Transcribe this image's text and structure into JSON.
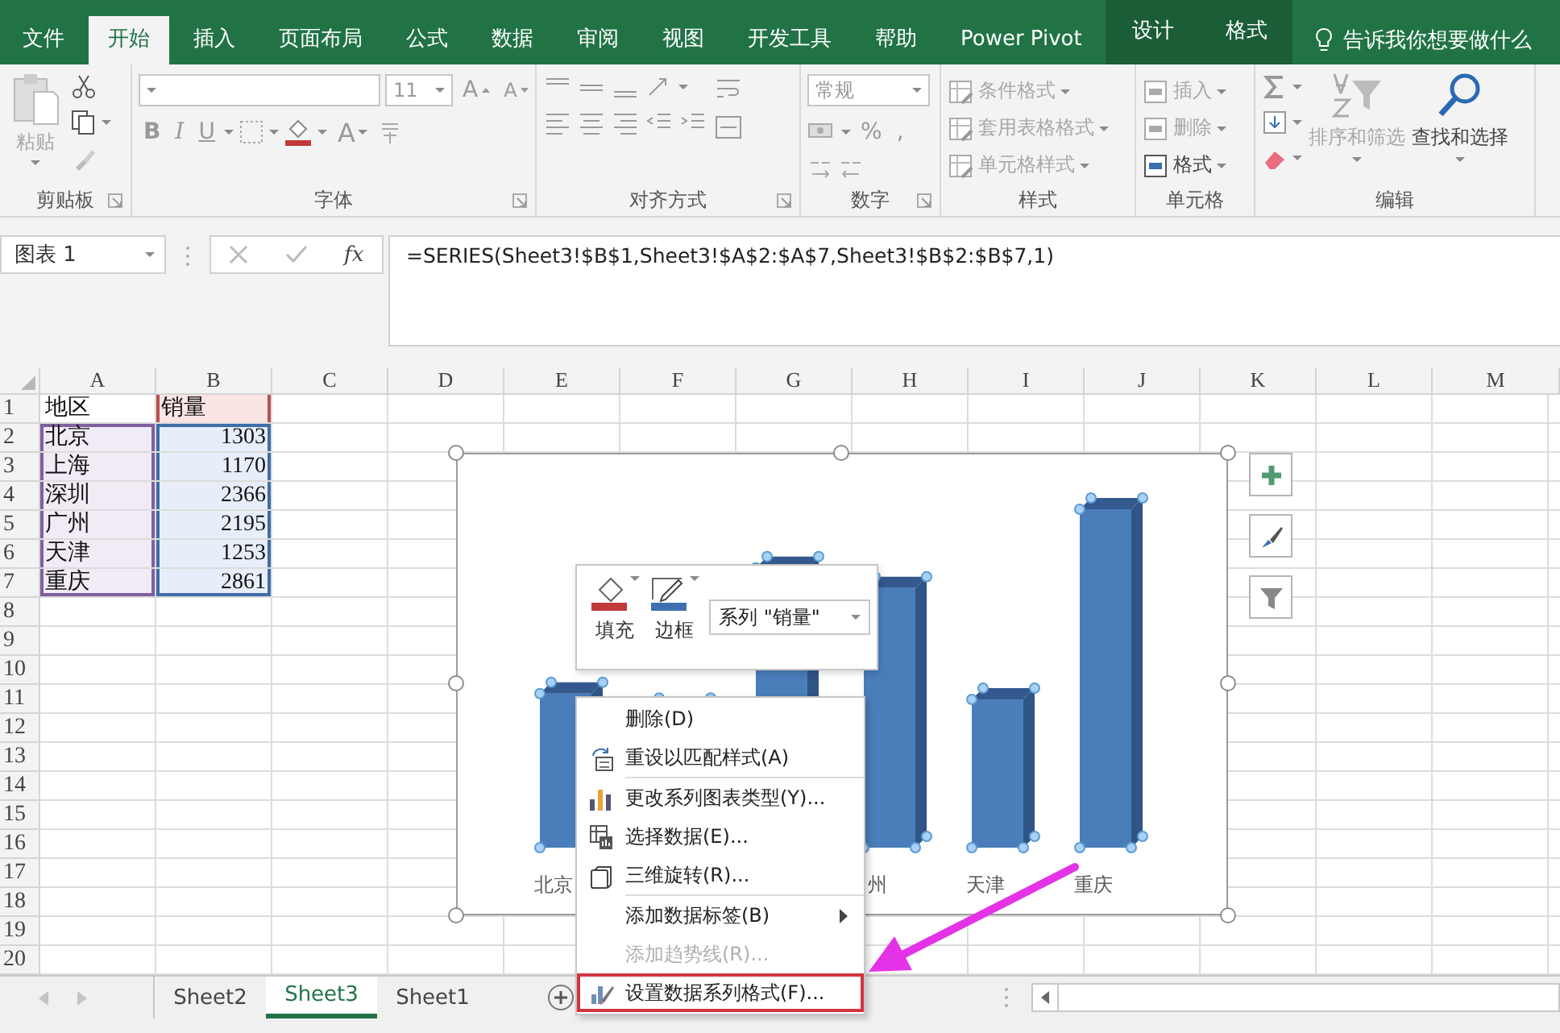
{
  "ribbon": {
    "tabs": [
      {
        "label": "文件",
        "selected": false,
        "contextual": false
      },
      {
        "label": "开始",
        "selected": true,
        "contextual": false
      },
      {
        "label": "插入",
        "selected": false,
        "contextual": false
      },
      {
        "label": "页面布局",
        "selected": false,
        "contextual": false
      },
      {
        "label": "公式",
        "selected": false,
        "contextual": false
      },
      {
        "label": "数据",
        "selected": false,
        "contextual": false
      },
      {
        "label": "审阅",
        "selected": false,
        "contextual": false
      },
      {
        "label": "视图",
        "selected": false,
        "contextual": false
      },
      {
        "label": "开发工具",
        "selected": false,
        "contextual": false
      },
      {
        "label": "帮助",
        "selected": false,
        "contextual": false
      },
      {
        "label": "Power Pivot",
        "selected": false,
        "contextual": false
      },
      {
        "label": "设计",
        "selected": false,
        "contextual": true
      },
      {
        "label": "格式",
        "selected": false,
        "contextual": true
      }
    ],
    "tell_me": "告诉我你想要做什么",
    "groups": [
      {
        "kind": "clipboard",
        "label": "剪贴板",
        "launcher": true,
        "paste": {
          "label": "粘贴",
          "disabled": true
        }
      },
      {
        "kind": "font",
        "label": "字体",
        "launcher": true,
        "font_size": "11",
        "grow": "A",
        "shrink": "A",
        "styles": [
          "B",
          "I",
          "U"
        ],
        "font_color": "A"
      },
      {
        "kind": "alignment",
        "label": "对齐方式",
        "launcher": true
      },
      {
        "kind": "number",
        "label": "数字",
        "launcher": true,
        "format": "常规",
        "percent": "%",
        "comma": ","
      },
      {
        "kind": "styles",
        "label": "样式",
        "launcher": false,
        "items": [
          {
            "label": "条件格式",
            "disabled": true
          },
          {
            "label": "套用表格格式",
            "disabled": true
          },
          {
            "label": "单元格样式",
            "disabled": true
          }
        ]
      },
      {
        "kind": "cells",
        "label": "单元格",
        "launcher": false,
        "items": [
          {
            "label": "插入",
            "disabled": true
          },
          {
            "label": "删除",
            "disabled": true
          },
          {
            "label": "格式",
            "disabled": false
          }
        ]
      },
      {
        "kind": "editing",
        "label": "编辑",
        "launcher": false,
        "items": [
          {
            "label": "排序和筛选",
            "disabled": true
          },
          {
            "label": "查找和选择",
            "disabled": false
          }
        ]
      }
    ]
  },
  "formula_bar": {
    "name_box": "图表 1",
    "function_button": "fx",
    "formula": "=SERIES(Sheet3!$B$1,Sheet3!$A$2:$A$7,Sheet3!$B$2:$B$7,1)"
  },
  "sheet": {
    "columns": [
      "A",
      "B",
      "C",
      "D",
      "E",
      "F",
      "G",
      "H",
      "I",
      "J",
      "K",
      "L",
      "M"
    ],
    "rows": [
      "1",
      "2",
      "3",
      "4",
      "5",
      "6",
      "7",
      "8",
      "9",
      "10",
      "11",
      "12",
      "13",
      "14",
      "15",
      "16",
      "17",
      "18",
      "19",
      "20"
    ],
    "cells": [
      [
        "地区",
        "销量"
      ],
      [
        "北京",
        "1303"
      ],
      [
        "上海",
        "1170"
      ],
      [
        "深圳",
        "2366"
      ],
      [
        "广州",
        "2195"
      ],
      [
        "天津",
        "1253"
      ],
      [
        "重庆",
        "2861"
      ]
    ],
    "ranges": [
      {
        "kind": "categories"
      },
      {
        "kind": "values"
      }
    ],
    "series_name_marked": true
  },
  "chart": {
    "selected": true,
    "axis_labels": [
      "北京",
      "州",
      "天津",
      "重庆"
    ]
  },
  "mini_toolbar": {
    "fill": "填充",
    "outline": "边框",
    "series": "系列 \"销量\""
  },
  "context_menu": [
    {
      "label": "删除(D)",
      "kind": "plain",
      "disabled": false,
      "submenu": false,
      "separator_after": false,
      "annotated": false
    },
    {
      "label": "重设以匹配样式(A)",
      "kind": "reset",
      "disabled": false,
      "submenu": false,
      "separator_after": true,
      "annotated": false
    },
    {
      "label": "更改系列图表类型(Y)...",
      "kind": "chart-type",
      "disabled": false,
      "submenu": false,
      "separator_after": false,
      "annotated": false
    },
    {
      "label": "选择数据(E)...",
      "kind": "select-data",
      "disabled": false,
      "submenu": false,
      "separator_after": false,
      "annotated": false
    },
    {
      "label": "三维旋转(R)...",
      "kind": "rotate",
      "disabled": false,
      "submenu": false,
      "separator_after": true,
      "annotated": false
    },
    {
      "label": "添加数据标签(B)",
      "kind": "plain",
      "disabled": false,
      "submenu": true,
      "separator_after": false,
      "annotated": false
    },
    {
      "label": "添加趋势线(R)...",
      "kind": "plain",
      "disabled": true,
      "submenu": false,
      "separator_after": false,
      "annotated": false
    },
    {
      "label": "设置数据系列格式(F)...",
      "kind": "format",
      "disabled": false,
      "submenu": false,
      "separator_after": false,
      "annotated": true
    }
  ],
  "sheet_tabs": [
    {
      "label": "Sheet2",
      "selected": false
    },
    {
      "label": "Sheet3",
      "selected": true
    },
    {
      "label": "Sheet1",
      "selected": false
    }
  ]
}
